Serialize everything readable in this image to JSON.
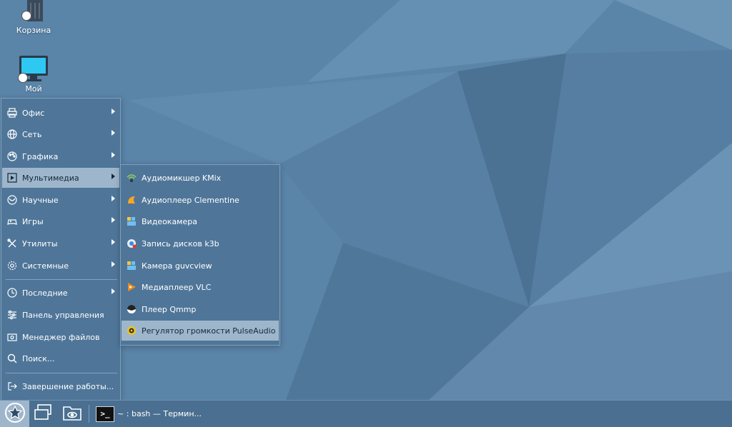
{
  "desktop": {
    "icons": [
      {
        "label": "Корзина"
      },
      {
        "label": "Мой"
      }
    ]
  },
  "start_menu": {
    "items": [
      {
        "label": "Офис",
        "icon": "printer-icon",
        "submenu": true
      },
      {
        "label": "Сеть",
        "icon": "globe-icon",
        "submenu": true
      },
      {
        "label": "Графика",
        "icon": "palette-icon",
        "submenu": true
      },
      {
        "label": "Мультимедиа",
        "icon": "play-icon",
        "submenu": true,
        "active": true
      },
      {
        "label": "Научные",
        "icon": "atom-icon",
        "submenu": true
      },
      {
        "label": "Игры",
        "icon": "gamepad-icon",
        "submenu": true
      },
      {
        "label": "Утилиты",
        "icon": "tools-icon",
        "submenu": true
      },
      {
        "label": "Системные",
        "icon": "gear-icon",
        "submenu": true
      },
      {
        "label": "Последние",
        "icon": "clock-icon",
        "submenu": true
      },
      {
        "label": "Панель управления",
        "icon": "sliders-icon",
        "submenu": false
      },
      {
        "label": "Менеджер файлов",
        "icon": "file-manager-icon",
        "submenu": false
      },
      {
        "label": "Поиск...",
        "icon": "search-icon",
        "submenu": false
      },
      {
        "label": "Завершение работы...",
        "icon": "logout-icon",
        "submenu": false
      }
    ]
  },
  "multimedia_submenu": {
    "items": [
      {
        "label": "Аудиомикшер KMix",
        "icon": "kmix-icon"
      },
      {
        "label": "Аудиоплеер Clementine",
        "icon": "clementine-icon"
      },
      {
        "label": "Видеокамера",
        "icon": "camera-icon"
      },
      {
        "label": "Запись дисков k3b",
        "icon": "k3b-icon"
      },
      {
        "label": "Камера guvcview",
        "icon": "guvcview-icon"
      },
      {
        "label": "Медиаплеер VLC",
        "icon": "vlc-icon"
      },
      {
        "label": "Плеер Qmmp",
        "icon": "qmmp-icon"
      },
      {
        "label": "Регулятор громкости PulseAudio",
        "icon": "pulseaudio-icon",
        "active": true
      }
    ]
  },
  "taskbar": {
    "tasks": [
      {
        "label": "~ : bash — Термин...",
        "icon_text": ">_"
      }
    ]
  }
}
